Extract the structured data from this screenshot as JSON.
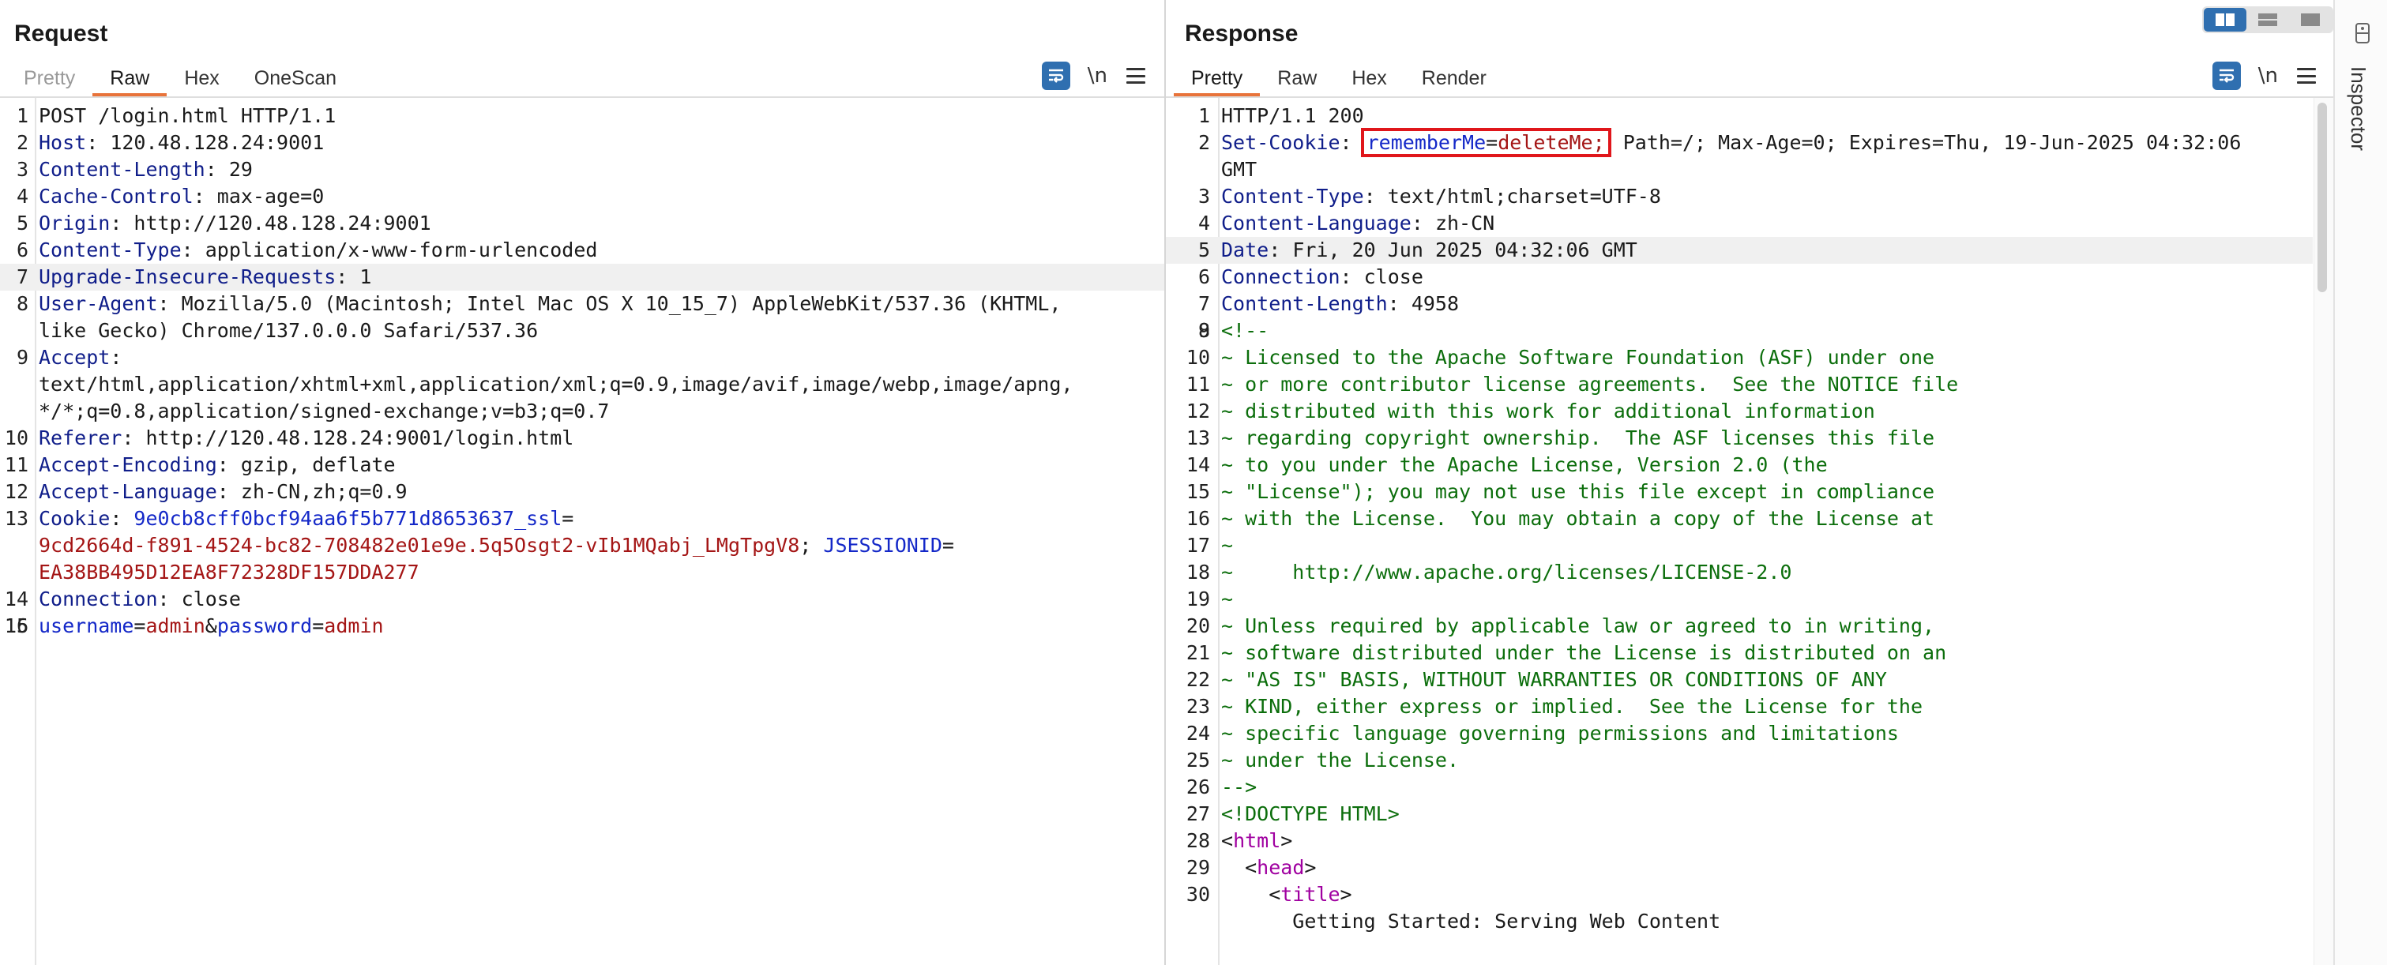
{
  "request": {
    "title": "Request",
    "tabs": [
      "Pretty",
      "Raw",
      "Hex",
      "OneScan"
    ],
    "active_tab": "Raw",
    "tools": {
      "wrap_icon": "word-wrap-icon",
      "newline_label": "\\n",
      "menu_icon": "hamburger-menu-icon"
    },
    "lines": [
      {
        "n": "1",
        "t": "POST /login.html HTTP/1.1"
      },
      {
        "n": "2",
        "k": "Host",
        "v": "120.48.128.24:9001"
      },
      {
        "n": "3",
        "k": "Content-Length",
        "v": "29"
      },
      {
        "n": "4",
        "k": "Cache-Control",
        "v": "max-age=0"
      },
      {
        "n": "5",
        "k": "Origin",
        "v": "http://120.48.128.24:9001"
      },
      {
        "n": "6",
        "k": "Content-Type",
        "v": "application/x-www-form-urlencoded"
      },
      {
        "n": "7",
        "k": "Upgrade-Insecure-Requests",
        "v": "1",
        "hl": true
      },
      {
        "n": "8",
        "k": "User-Agent",
        "v": "Mozilla/5.0 (Macintosh; Intel Mac OS X 10_15_7) AppleWebKit/537.36 (KHTML,"
      },
      {
        "n": "",
        "t": "like Gecko) Chrome/137.0.0.0 Safari/537.36"
      },
      {
        "n": "9",
        "k": "Accept",
        "v": ""
      },
      {
        "n": "",
        "t": "text/html,application/xhtml+xml,application/xml;q=0.9,image/avif,image/webp,image/apng,"
      },
      {
        "n": "",
        "t": "*/*;q=0.8,application/signed-exchange;v=b3;q=0.7"
      },
      {
        "n": "10",
        "k": "Referer",
        "v": "http://120.48.128.24:9001/login.html"
      },
      {
        "n": "11",
        "k": "Accept-Encoding",
        "v": "gzip, deflate"
      },
      {
        "n": "12",
        "k": "Accept-Language",
        "v": "zh-CN,zh;q=0.9"
      },
      {
        "n": "13",
        "cookie1": {
          "key": "Cookie",
          "name": "9e0cb8cff0bcf94aa6f5b771d8653637_ssl",
          "eq": "="
        }
      },
      {
        "n": "",
        "cookie2": {
          "val": "9cd2664d-f891-4524-bc82-708482e01e9e.5q5Osgt2-vIb1MQabj_LMgTpgV8",
          "sep": "; ",
          "name": "JSESSIONID",
          "eq": "="
        }
      },
      {
        "n": "",
        "red": "EA38BB495D12EA8F72328DF157DDA277"
      },
      {
        "n": "14",
        "k": "Connection",
        "v": "close"
      },
      {
        "n": "15",
        "t": ""
      },
      {
        "n": "16",
        "body": {
          "p1": "username",
          "eq1": "=",
          "v1": "admin",
          "amp": "&",
          "p2": "password",
          "eq2": "=",
          "v2": "admin"
        }
      }
    ]
  },
  "response": {
    "title": "Response",
    "tabs": [
      "Pretty",
      "Raw",
      "Hex",
      "Render"
    ],
    "active_tab": "Pretty",
    "layout_modes": [
      "split-horizontal",
      "split-vertical",
      "single"
    ],
    "lines": [
      {
        "n": "1",
        "t": "HTTP/1.1 200"
      },
      {
        "n": "2",
        "setcookie": {
          "key": "Set-Cookie",
          "name": "rememberMe",
          "eq": "=",
          "val": "deleteMe;",
          "rest": " Path=/; Max-Age=0; Expires=Thu, 19-Jun-2025 04:32:06"
        }
      },
      {
        "n": "",
        "t": "GMT"
      },
      {
        "n": "3",
        "k": "Content-Type",
        "v": "text/html;charset=UTF-8"
      },
      {
        "n": "4",
        "k": "Content-Language",
        "v": "zh-CN"
      },
      {
        "n": "5",
        "k": "Date",
        "v": "Fri, 20 Jun 2025 04:32:06 GMT",
        "hl": true
      },
      {
        "n": "6",
        "k": "Connection",
        "v": "close"
      },
      {
        "n": "7",
        "k": "Content-Length",
        "v": "4958"
      },
      {
        "n": "8",
        "t": ""
      },
      {
        "n": "9",
        "c": "<!--"
      },
      {
        "n": "10",
        "c": "~ Licensed to the Apache Software Foundation (ASF) under one"
      },
      {
        "n": "11",
        "c": "~ or more contributor license agreements.  See the NOTICE file"
      },
      {
        "n": "12",
        "c": "~ distributed with this work for additional information"
      },
      {
        "n": "13",
        "c": "~ regarding copyright ownership.  The ASF licenses this file"
      },
      {
        "n": "14",
        "c": "~ to you under the Apache License, Version 2.0 (the"
      },
      {
        "n": "15",
        "c": "~ \"License\"); you may not use this file except in compliance"
      },
      {
        "n": "16",
        "c": "~ with the License.  You may obtain a copy of the License at"
      },
      {
        "n": "17",
        "c": "~"
      },
      {
        "n": "18",
        "c": "~     http://www.apache.org/licenses/LICENSE-2.0"
      },
      {
        "n": "19",
        "c": "~"
      },
      {
        "n": "20",
        "c": "~ Unless required by applicable law or agreed to in writing,"
      },
      {
        "n": "21",
        "c": "~ software distributed under the License is distributed on an"
      },
      {
        "n": "22",
        "c": "~ \"AS IS\" BASIS, WITHOUT WARRANTIES OR CONDITIONS OF ANY"
      },
      {
        "n": "23",
        "c": "~ KIND, either express or implied.  See the License for the"
      },
      {
        "n": "24",
        "c": "~ specific language governing permissions and limitations"
      },
      {
        "n": "25",
        "c": "~ under the License."
      },
      {
        "n": "26",
        "c": "-->"
      },
      {
        "n": "27",
        "c": "<!DOCTYPE HTML>"
      },
      {
        "n": "28",
        "tagline": {
          "indent": "",
          "open": "<",
          "name": "html",
          "close": ">"
        }
      },
      {
        "n": "29",
        "tagline": {
          "indent": "  ",
          "open": "<",
          "name": "head",
          "close": ">"
        }
      },
      {
        "n": "30",
        "tagline": {
          "indent": "    ",
          "open": "<",
          "name": "title",
          "close": ">"
        }
      },
      {
        "n": "",
        "t": "      Getting Started: Serving Web Content"
      }
    ]
  },
  "inspector": {
    "label": "Inspector",
    "icon": "inspector-panel-icon"
  },
  "colors": {
    "accent_tab": "#e8733a",
    "button_blue": "#2f6fb0",
    "header_key": "#101e8a",
    "value_red": "#a41515",
    "comment_green": "#0c6e0c",
    "highlight_box": "#e0161b"
  }
}
